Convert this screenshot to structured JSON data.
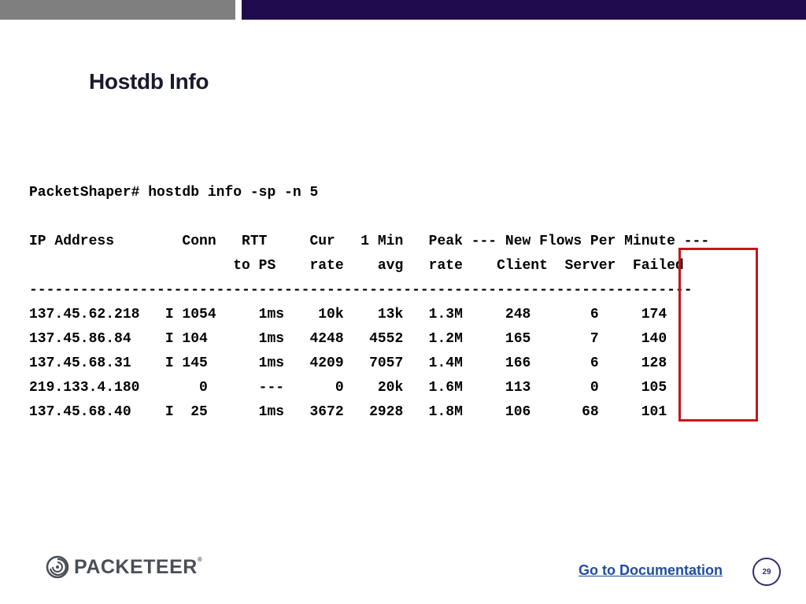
{
  "slide": {
    "title": "Hostdb Info",
    "terminal_lines": [
      "PacketShaper# hostdb info -sp -n 5",
      "",
      "IP Address        Conn   RTT     Cur   1 Min   Peak --- New Flows Per Minute ---",
      "                        to PS    rate    avg   rate    Client  Server  Failed",
      "------------------------------------------------------------------------------",
      "137.45.62.218   I 1054     1ms    10k    13k   1.3M     248       6     174",
      "137.45.86.84    I 104      1ms   4248   4552   1.2M     165       7     140",
      "137.45.68.31    I 145      1ms   4209   7057   1.4M     166       6     128",
      "219.133.4.180       0      ---      0    20k   1.6M     113       0     105",
      "137.45.68.40    I  25      1ms   3672   2928   1.8M     106      68     101"
    ]
  },
  "footer": {
    "logo_text": "PACKETEER",
    "logo_mark": "®",
    "doc_link": "Go to Documentation",
    "page_number": "29"
  },
  "colors": {
    "top_bar_gray": "#7f7f7f",
    "top_bar_purple": "#200a4e",
    "highlight": "#c4161c",
    "link": "#1f4e9e"
  }
}
